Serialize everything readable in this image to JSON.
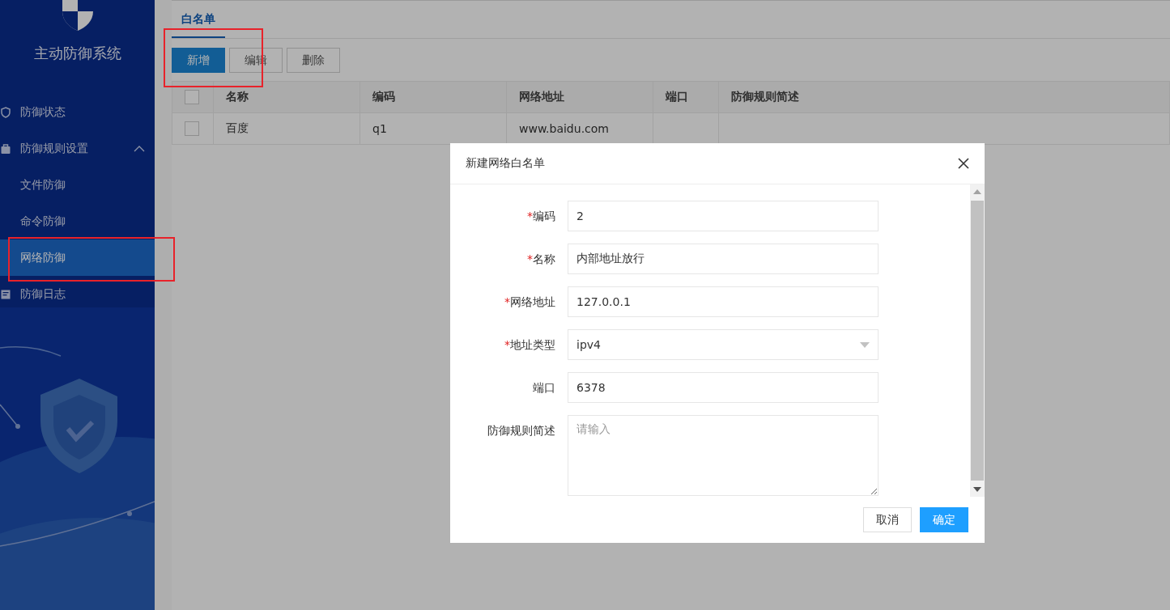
{
  "sidebar": {
    "title": "主动防御系统",
    "menu": [
      {
        "label": "防御状态",
        "selected": false
      },
      {
        "label": "防御规则设置",
        "selected": false,
        "expanded": true,
        "children": [
          {
            "label": "文件防御",
            "selected": false
          },
          {
            "label": "命令防御",
            "selected": false
          },
          {
            "label": "网络防御",
            "selected": true
          }
        ]
      },
      {
        "label": "防御日志",
        "selected": false
      }
    ]
  },
  "tabs": [
    {
      "label": "白名单",
      "selected": true
    }
  ],
  "toolbar": [
    {
      "label": "新增",
      "kind": "primary"
    },
    {
      "label": "编辑",
      "kind": "default"
    },
    {
      "label": "删除",
      "kind": "default"
    }
  ],
  "table": {
    "columns": [
      "名称",
      "编码",
      "网络地址",
      "端口",
      "防御规则简述"
    ],
    "header_checked": false,
    "rows": [
      {
        "checked": false,
        "cells": [
          "百度",
          "q1",
          "www.baidu.com",
          "",
          ""
        ]
      }
    ]
  },
  "dialog": {
    "title": "新建网络白名单",
    "fields": [
      {
        "label": "编码",
        "required_mark": "*",
        "kind": "input",
        "value": "2"
      },
      {
        "label": "名称",
        "required_mark": "*",
        "kind": "input",
        "value": "内部地址放行"
      },
      {
        "label": "网络地址",
        "required_mark": "*",
        "kind": "input",
        "value": "127.0.0.1"
      },
      {
        "label": "地址类型",
        "required_mark": "*",
        "kind": "select",
        "value": "ipv4"
      },
      {
        "label": "端口",
        "kind": "input",
        "value": "6378"
      },
      {
        "label": "防御规则简述",
        "kind": "textarea",
        "placeholder": "请输入"
      }
    ],
    "buttons": [
      {
        "label": "取消",
        "kind": "default"
      },
      {
        "label": "确定",
        "kind": "primary"
      }
    ]
  }
}
